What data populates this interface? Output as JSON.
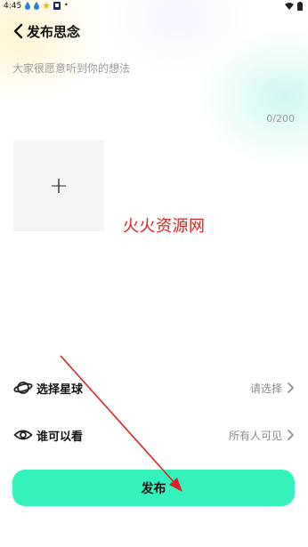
{
  "status_bar": {
    "time": "4:45",
    "left_icons": [
      "water-drop-icon",
      "water-drop-icon",
      "star-icon",
      "app-notification-icon",
      "more-dot-icon"
    ],
    "right_icons": [
      "wifi-icon",
      "battery-icon"
    ]
  },
  "header": {
    "title": "发布思念",
    "back_icon": "chevron-left-icon"
  },
  "content": {
    "placeholder": "大家很愿意听到你的想法",
    "value": "",
    "char_count": "0/200"
  },
  "media": {
    "add_label": "+"
  },
  "watermark": {
    "text": "火火资源网",
    "color": "#e02020"
  },
  "options": {
    "planet": {
      "icon": "planet-icon",
      "label": "选择星球",
      "value": "请选择"
    },
    "visibility": {
      "icon": "eye-icon",
      "label": "谁可以看",
      "value": "所有人可见"
    }
  },
  "publish": {
    "label": "发布",
    "color": "#35f2bd"
  },
  "annotation": {
    "arrow_color": "#e02020"
  }
}
